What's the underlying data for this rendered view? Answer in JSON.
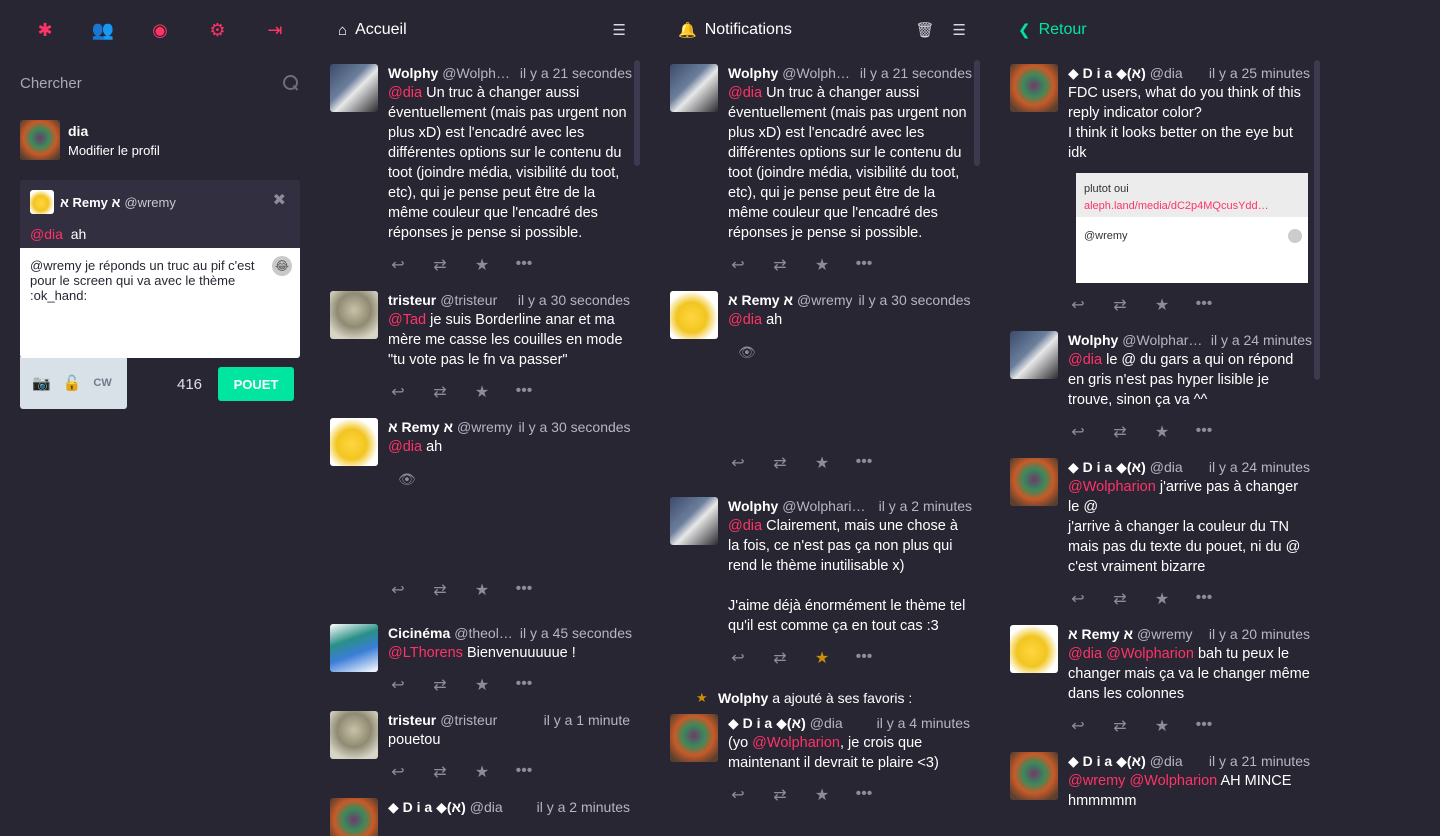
{
  "drawer": {
    "search_placeholder": "Chercher",
    "self": {
      "name": "dia",
      "edit_label": "Modifier le profil"
    },
    "reply_to": {
      "name": "א Remy א",
      "acct": "@wremy",
      "mention": "@dia",
      "text": "ah"
    },
    "compose_text": "@wremy je réponds un truc au pif c'est pour le screen qui va avec le thème :ok_hand:",
    "cw_label": "CW",
    "counter": "416",
    "submit_label": "POUET"
  },
  "columns": {
    "home": {
      "title": "Accueil"
    },
    "notifications": {
      "title": "Notifications"
    },
    "thread": {
      "back_label": "Retour"
    }
  },
  "home_statuses": [
    {
      "name": "Wolphy",
      "acct": "@Wolphari…",
      "time": "il y a 21 secondes",
      "mention": "@dia",
      "text": "Un truc à changer aussi éventuellement (mais pas urgent non plus xD) est l'encadré avec les différentes options sur le contenu du toot (joindre média, visibilité du toot, etc), qui je pense peut être de la même couleur que l'encadré des réponses je pense si possible."
    },
    {
      "name": "tristeur",
      "acct": "@tristeur",
      "time": "il y a 30 secondes",
      "mention": "@Tad",
      "text": "je suis Borderline anar et ma mère me casse les couilles en mode \"tu vote pas le fn va passer\""
    },
    {
      "name": "א Remy א",
      "acct": "@wremy",
      "time": "il y a 30 secondes",
      "mention": "@dia",
      "text": "ah"
    },
    {
      "name": "Cicinéma",
      "acct": "@theolo…",
      "time": "il y a 45 secondes",
      "mention": "@LThorens",
      "text": "Bienvenuuuuue !"
    },
    {
      "name": "tristeur",
      "acct": "@tristeur",
      "time": "il y a 1 minute",
      "mention": "",
      "text": "pouetou"
    },
    {
      "name": "◆ D i a ◆(א)",
      "acct": "@dia",
      "time": "il y a 2 minutes",
      "mention": "",
      "text": ""
    }
  ],
  "notif_statuses": [
    {
      "name": "Wolphy",
      "acct": "@Wolphari…",
      "time": "il y a 21 secondes",
      "mention": "@dia",
      "text": "Un truc à changer aussi éventuellement (mais pas urgent non plus xD) est l'encadré avec les différentes options sur le contenu du toot (joindre média, visibilité du toot, etc), qui je pense peut être de la même couleur que l'encadré des réponses je pense si possible."
    },
    {
      "name": "א Remy א",
      "acct": "@wremy",
      "time": "il y a 30 secondes",
      "mention": "@dia",
      "text": "ah"
    },
    {
      "name": "Wolphy",
      "acct": "@Wolpharion…",
      "time": "il y a 2 minutes",
      "mention": "@dia",
      "text": "Clairement, mais une chose à la fois, ce n'est pas ça non plus qui rend le thème inutilisable x)\n\nJ'aime déjà énormément le thème tel qu'il est comme ça en tout cas :3"
    },
    {
      "fav_by": "Wolphy",
      "fav_text": "a ajouté à ses favoris :",
      "name": "◆ D i a ◆(א)",
      "acct": "@dia",
      "time": "il y a 4 minutes",
      "prefix": "(yo ",
      "mention": "@Wolpharion",
      "text": ", je crois que maintenant il devrait te plaire <3)"
    }
  ],
  "thread_statuses": [
    {
      "name": "◆ D i a ◆(א)",
      "acct": "@dia",
      "time": "il y a 25 minutes",
      "mention": "",
      "text": "FDC users, what do you think of this reply indicator color?\nI think it looks better on the eye but idk",
      "preview": {
        "line1": "plutot oui",
        "line2": "aleph.land/media/dC2p4MQcusYdd…",
        "line3": "@wremy"
      }
    },
    {
      "name": "Wolphy",
      "acct": "@Wolphario…",
      "time": "il y a 24 minutes",
      "mention": "@dia",
      "text": "le @ du gars a qui on répond en gris n'est pas hyper lisible je trouve, sinon ça va ^^"
    },
    {
      "name": "◆ D i a ◆(א)",
      "acct": "@dia",
      "time": "il y a 24 minutes",
      "mention": "@Wolpharion",
      "text": "j'arrive pas à changer le @\nj'arrive à changer la couleur du TN mais pas du texte du pouet, ni du @ c'est vraiment bizarre"
    },
    {
      "name": "א Remy א",
      "acct": "@wremy",
      "time": "il y a 20 minutes",
      "mention": "@dia @Wolpharion",
      "text": "bah tu peux le changer mais ça va le changer même dans les colonnes"
    },
    {
      "name": "◆ D i a ◆(א)",
      "acct": "@dia",
      "time": "il y a 21 minutes",
      "mention": "@wremy @Wolpharion",
      "text": "AH MINCE hmmmmm"
    }
  ]
}
